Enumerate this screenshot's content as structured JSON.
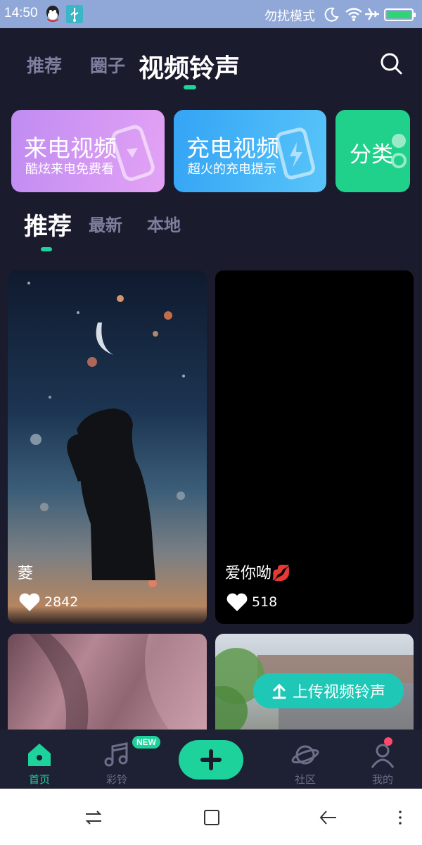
{
  "status_bar": {
    "time": "14:50",
    "dnd_label": "勿扰模式"
  },
  "header": {
    "tabs": [
      {
        "label": "推荐",
        "active": false
      },
      {
        "label": "圈子",
        "active": false
      },
      {
        "label": "视频铃声",
        "active": true
      }
    ]
  },
  "cards": [
    {
      "title": "来电视频",
      "subtitle": "酷炫来电免费看"
    },
    {
      "title": "充电视频",
      "subtitle": "超火的充电提示"
    },
    {
      "title": "分类",
      "subtitle": ""
    }
  ],
  "sub_tabs": [
    {
      "label": "推荐",
      "active": true
    },
    {
      "label": "最新",
      "active": false
    },
    {
      "label": "本地",
      "active": false
    }
  ],
  "videos": [
    {
      "caption": "菱",
      "likes": "2842"
    },
    {
      "caption": "爱你呦💋",
      "likes": "518"
    }
  ],
  "upload_button": {
    "label": "上传视频铃声"
  },
  "bottom_nav": {
    "items": [
      {
        "label": "首页",
        "icon": "home-icon",
        "active": true
      },
      {
        "label": "彩铃",
        "icon": "music-note-icon",
        "active": false,
        "badge": "NEW"
      },
      {
        "label": "",
        "icon": "plus-icon",
        "active": false
      },
      {
        "label": "社区",
        "icon": "planet-icon",
        "active": false
      },
      {
        "label": "我的",
        "icon": "user-icon",
        "active": false
      }
    ]
  },
  "colors": {
    "accent": "#1ed29b",
    "background": "#1b1b2e",
    "status_bar": "#8fa8d8"
  }
}
